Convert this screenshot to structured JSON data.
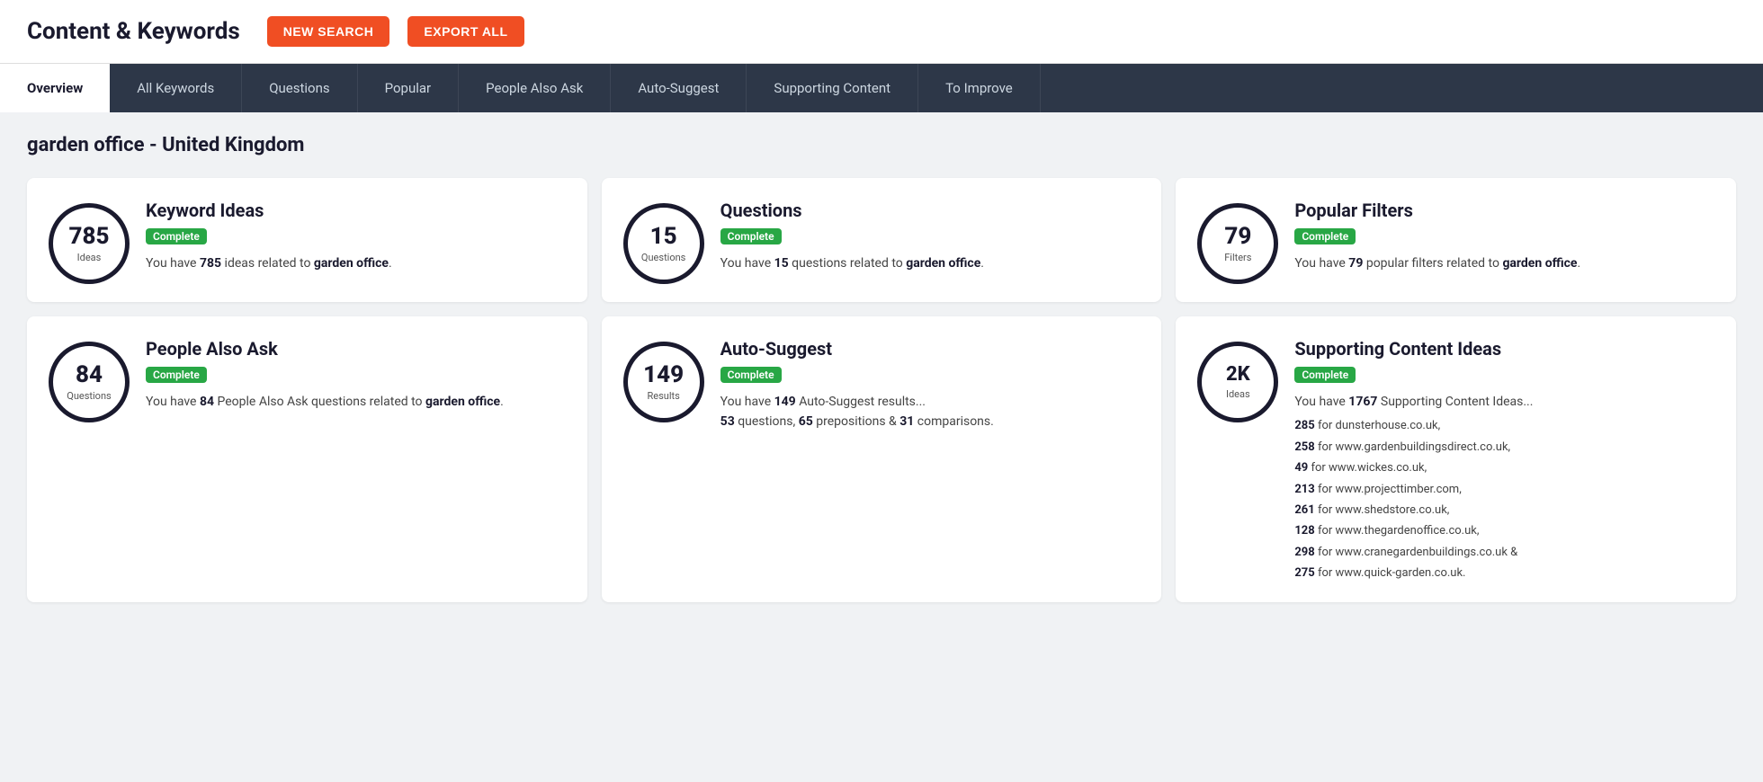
{
  "header": {
    "title": "Content & Keywords",
    "btn_new_search": "NEW SEARCH",
    "btn_export_all": "EXPORT ALL"
  },
  "nav": {
    "tabs": [
      {
        "label": "Overview",
        "active": true
      },
      {
        "label": "All Keywords",
        "active": false
      },
      {
        "label": "Questions",
        "active": false
      },
      {
        "label": "Popular",
        "active": false
      },
      {
        "label": "People Also Ask",
        "active": false
      },
      {
        "label": "Auto-Suggest",
        "active": false
      },
      {
        "label": "Supporting Content",
        "active": false
      },
      {
        "label": "To Improve",
        "active": false
      }
    ]
  },
  "page": {
    "subtitle": "garden office - United Kingdom"
  },
  "cards": [
    {
      "id": "keyword-ideas",
      "circle_number": "785",
      "circle_number_size": "normal",
      "circle_label": "Ideas",
      "title": "Keyword Ideas",
      "badge": "Complete",
      "desc_parts": [
        {
          "text": "You have "
        },
        {
          "text": "785",
          "bold": true
        },
        {
          "text": " ideas related to "
        },
        {
          "text": "garden office",
          "bold": true
        },
        {
          "text": "."
        }
      ],
      "extra_lines": []
    },
    {
      "id": "questions",
      "circle_number": "15",
      "circle_number_size": "normal",
      "circle_label": "Questions",
      "title": "Questions",
      "badge": "Complete",
      "desc_parts": [
        {
          "text": "You have "
        },
        {
          "text": "15",
          "bold": true
        },
        {
          "text": " questions related to "
        },
        {
          "text": "garden office",
          "bold": true
        },
        {
          "text": "."
        }
      ],
      "extra_lines": []
    },
    {
      "id": "popular-filters",
      "circle_number": "79",
      "circle_number_size": "normal",
      "circle_label": "Filters",
      "title": "Popular Filters",
      "badge": "Complete",
      "desc_parts": [
        {
          "text": "You have "
        },
        {
          "text": "79",
          "bold": true
        },
        {
          "text": " popular filters related to "
        },
        {
          "text": "garden office",
          "bold": true
        },
        {
          "text": "."
        }
      ],
      "extra_lines": []
    },
    {
      "id": "people-also-ask",
      "circle_number": "84",
      "circle_number_size": "normal",
      "circle_label": "Questions",
      "title": "People Also Ask",
      "badge": "Complete",
      "desc_parts": [
        {
          "text": "You have "
        },
        {
          "text": "84",
          "bold": true
        },
        {
          "text": " People Also Ask questions related to "
        },
        {
          "text": "garden office",
          "bold": true
        },
        {
          "text": "."
        }
      ],
      "extra_lines": []
    },
    {
      "id": "auto-suggest",
      "circle_number": "149",
      "circle_number_size": "normal",
      "circle_label": "Results",
      "title": "Auto-Suggest",
      "badge": "Complete",
      "desc_parts": [
        {
          "text": "You have "
        },
        {
          "text": "149",
          "bold": true
        },
        {
          "text": " Auto-Suggest results..."
        }
      ],
      "extra_lines": [
        {
          "text": "53",
          "bold": true
        },
        {
          "text": " questions, "
        },
        {
          "text": "65",
          "bold": true
        },
        {
          "text": " prepositions & "
        },
        {
          "text": "31",
          "bold": true
        },
        {
          "text": " comparisons."
        }
      ]
    },
    {
      "id": "supporting-content",
      "circle_number": "2K",
      "circle_number_size": "small",
      "circle_label": "Ideas",
      "title": "Supporting Content Ideas",
      "badge": "Complete",
      "desc_parts": [
        {
          "text": "You have "
        },
        {
          "text": "1767",
          "bold": true
        },
        {
          "text": " Supporting Content Ideas..."
        }
      ],
      "supporting_lines": [
        "285 for dunsterhouse.co.uk,",
        "258 for www.gardenbuildingsdirect.co.uk,",
        "49 for www.wickes.co.uk,",
        "213 for www.projecttimber.com,",
        "261 for www.shedstore.co.uk,",
        "128 for www.thegardenoffice.co.uk,",
        "298 for www.cranegardenbuildings.co.uk &",
        "275 for www.quick-garden.co.uk."
      ],
      "supporting_bold_numbers": [
        "285",
        "258",
        "49",
        "213",
        "261",
        "128",
        "298",
        "275"
      ]
    }
  ]
}
